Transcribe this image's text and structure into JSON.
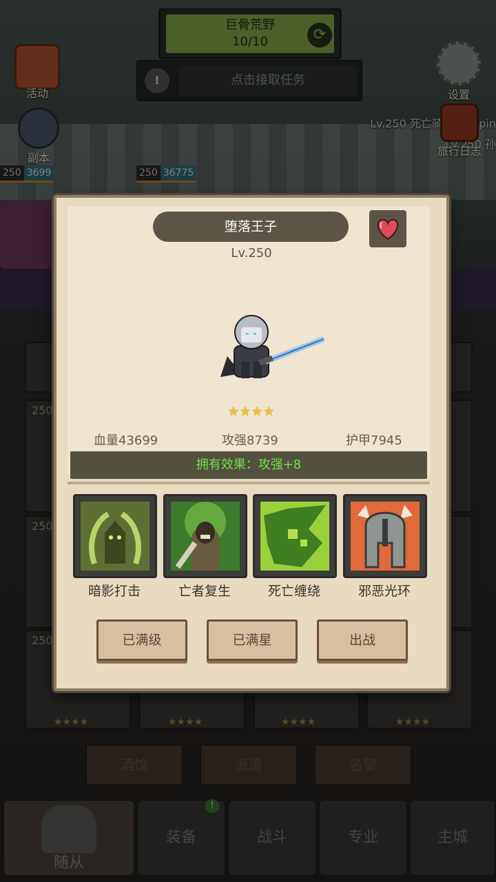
{
  "background": {
    "zone": {
      "name": "巨骨荒野",
      "progress": "10/10"
    },
    "quest": {
      "text": "点击接取任务"
    },
    "side_buttons": {
      "activity": "活动",
      "dungeon": "副本",
      "settings": "设置",
      "travel_log": "旅行日志"
    },
    "info_line": "Lv.250 死亡骑士：qqpin",
    "info_line2": "Lv.250 孙",
    "hp_badges": [
      {
        "level": "250",
        "hp": "3699"
      },
      {
        "level": "250",
        "hp": "36775"
      }
    ],
    "card_levels": [
      "250",
      "250",
      "250"
    ],
    "card_stars": "★★★★",
    "sub_tabs": [
      "酒馆",
      "派遣",
      "名望"
    ],
    "nav_tabs": [
      "随从",
      "装备",
      "战斗",
      "专业",
      "主城"
    ]
  },
  "modal": {
    "hero_name": "堕落王子",
    "level": "Lv.250",
    "stars": "★★★★",
    "star_count": 4,
    "stats": {
      "hp": "血量43699",
      "attack": "攻强8739",
      "armor": "护甲7945"
    },
    "effect": "拥有效果：攻强+8",
    "skills": [
      {
        "name": "暗影打击",
        "icon": "shadow-strike-icon"
      },
      {
        "name": "亡者复生",
        "icon": "raise-dead-icon"
      },
      {
        "name": "死亡缠绕",
        "icon": "death-coil-icon"
      },
      {
        "name": "邪恶光环",
        "icon": "unholy-aura-icon"
      }
    ],
    "buttons": {
      "max_level": "已满级",
      "max_star": "已满星",
      "deploy": "出战"
    }
  },
  "colors": {
    "effect_text": "#6fe04a",
    "star": "#f2c230",
    "modal_bg": "#e8dbc0"
  }
}
